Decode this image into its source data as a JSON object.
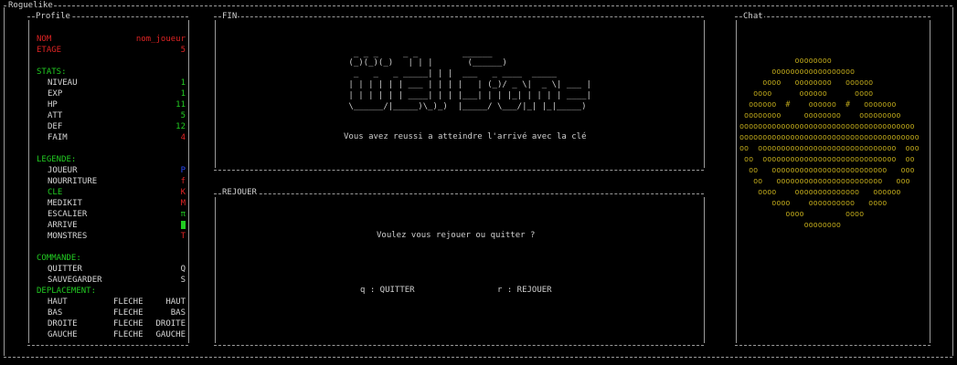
{
  "window": {
    "title": "Roguelike"
  },
  "profile": {
    "title": "Profile",
    "name_label": "NOM",
    "name_value": "nom_joueur",
    "stage_label": "ETAGE",
    "stage_value": "5",
    "stats_header": "STATS:",
    "stats": [
      {
        "label": "NIVEAU",
        "value": "1"
      },
      {
        "label": "EXP",
        "value": "1"
      },
      {
        "label": "HP",
        "value": "11"
      },
      {
        "label": "ATT",
        "value": "5"
      },
      {
        "label": "DEF",
        "value": "12"
      },
      {
        "label": "FAIM",
        "value": "4"
      }
    ],
    "legend_header": "LEGENDE:",
    "legend": [
      {
        "label": "JOUEUR",
        "symbol": "P"
      },
      {
        "label": "NOURRITURE",
        "symbol": "f"
      },
      {
        "label": "CLE",
        "symbol": "K"
      },
      {
        "label": "MEDIKIT",
        "symbol": "M"
      },
      {
        "label": "ESCALIER",
        "symbol": "π"
      },
      {
        "label": "ARRIVE",
        "symbol": ""
      },
      {
        "label": "MONSTRES",
        "symbol": "T"
      }
    ],
    "commands_header": "COMMANDE:",
    "commands": [
      {
        "label": "QUITTER",
        "key": "Q"
      },
      {
        "label": "SAUVEGARDER",
        "key": "S"
      }
    ],
    "movement_header": "DEPLACEMENT:",
    "movement": [
      {
        "label": "HAUT",
        "key": "FLECHE",
        "dir": "HAUT"
      },
      {
        "label": "BAS",
        "key": "FLECHE",
        "dir": "BAS"
      },
      {
        "label": "DROITE",
        "key": "FLECHE",
        "dir": "DROITE"
      },
      {
        "label": "GAUCHE",
        "key": "FLECHE",
        "dir": "GAUCHE"
      }
    ]
  },
  "fin": {
    "title": "FIN",
    "ascii_art": [
      "  _ _ _     _ _         ______",
      " (_)(_)(_)   | | |       (______)",
      "  _   _   _ _____| | |  ___   _ ____  _____",
      " | | | | | | ___ | | | |   | (_)/ _ \\|  _ \\| ___ |",
      " | | | | | | ____| | | |___| | | |_| | | | | ____|",
      " \\______/|_____)\\_)_)  |_____/ \\___/|_| |_|_____)"
    ],
    "message": "Vous avez reussi a atteindre l'arrivé avec la clé"
  },
  "rejouer": {
    "title": "REJOUER",
    "question": "Voulez vous rejouer ou quitter ?",
    "quit_option": "q : QUITTER",
    "replay_option": "r : REJOUER"
  },
  "chat": {
    "title": "Chat",
    "art": [
      "            oooooooo",
      "       oooooooooooooooooo",
      "     oooo   oooooooo   oooooo",
      "   oooo      oooooo      oooo",
      "  oooooo  #    oooooo  #   ooooooo",
      " oooooooo     oooooooo    ooooooooo",
      "oooooooooooooooooooooooooooooooooooooo",
      "ooooooooooooooooooooooooooooooooooooooo",
      "oo  oooooooooooooooooooooooooooooo  ooo",
      " oo  ooooooooooooooooooooooooooooo  oo",
      "  oo   ooooooooooooooooooooooooo   ooo",
      "   oo   ooooooooooooooooooooooo   ooo",
      "    oooo    oooooooooooooo   oooooo",
      "       oooo    oooooooooo   oooo",
      "          oooo         oooo",
      "              oooooooo"
    ]
  },
  "colors": {
    "label_red": "#e02424",
    "label_green": "#22cc22",
    "value_green": "#22cc22",
    "player_blue": "#2a4bff",
    "cat_yellow": "#b9a31a",
    "border": "#9a9a9a"
  }
}
